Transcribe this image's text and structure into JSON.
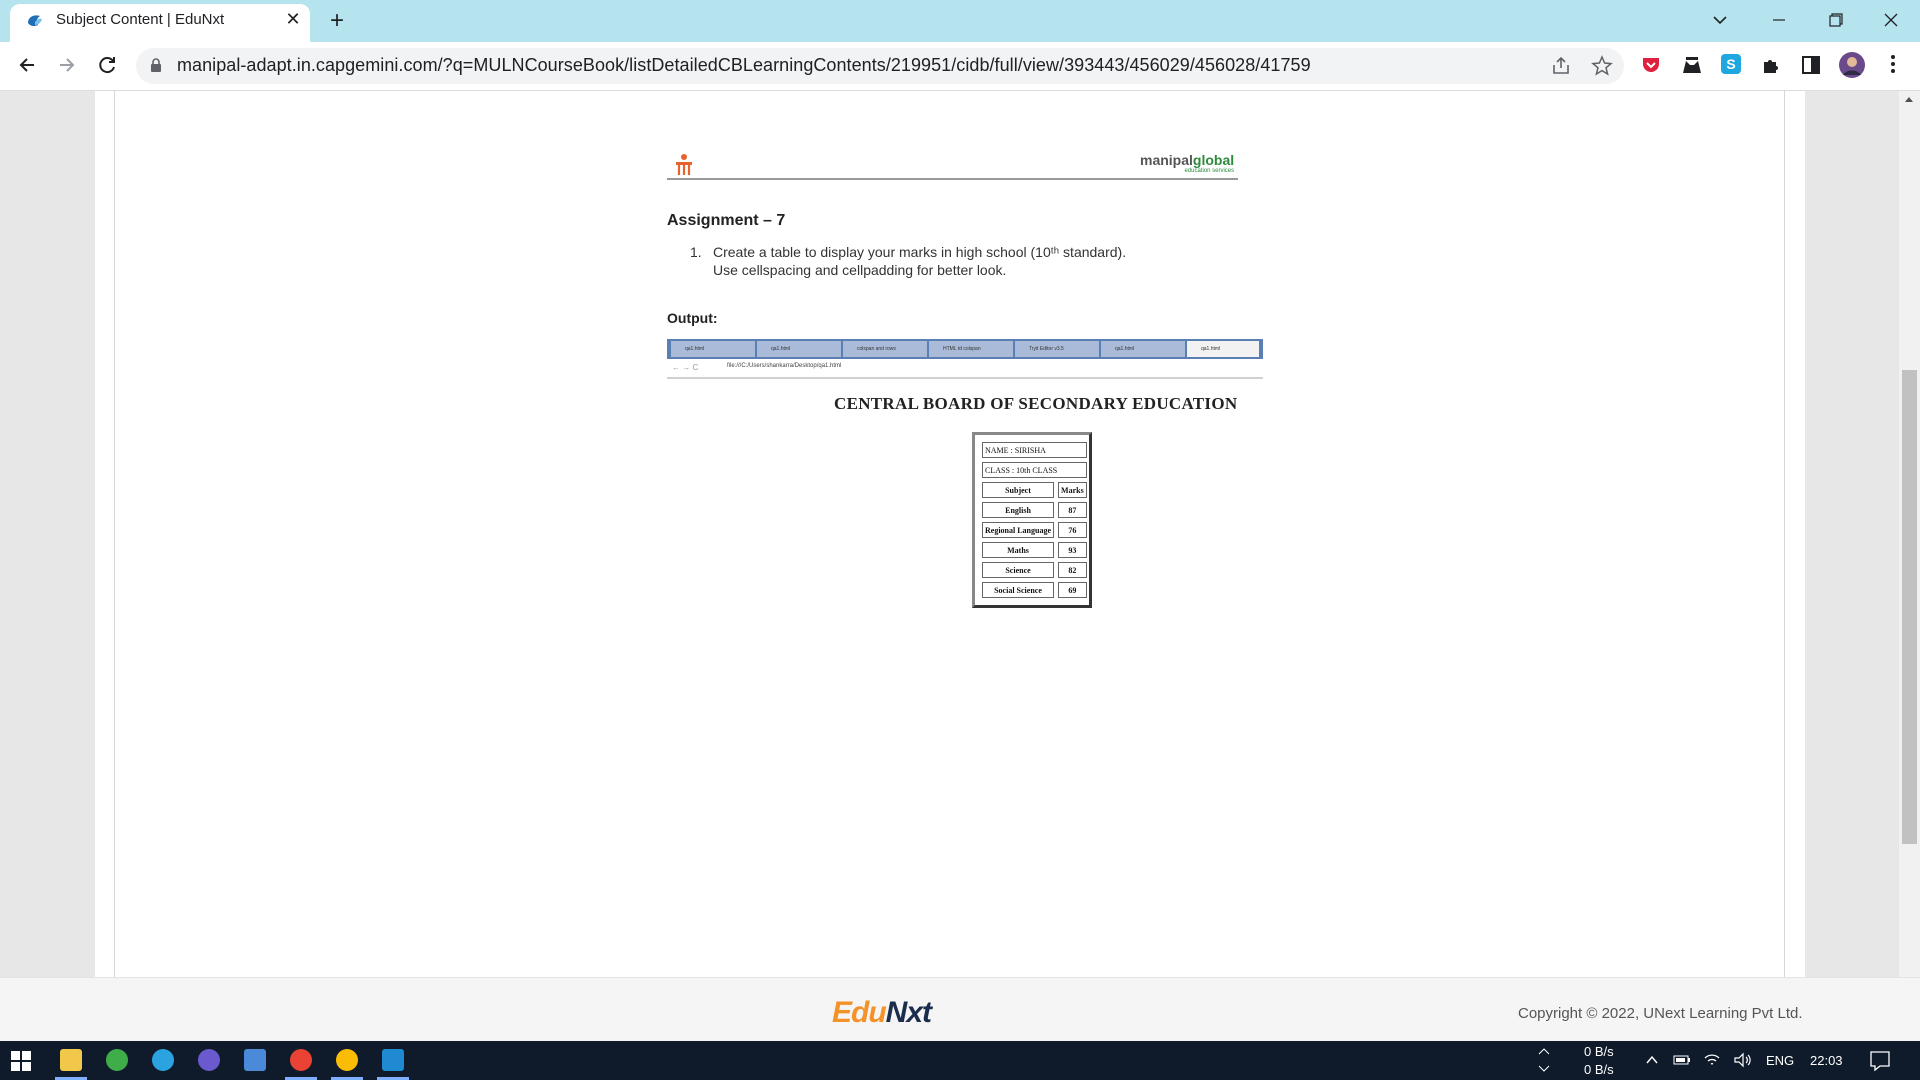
{
  "browser": {
    "tab_title": "Subject Content | EduNxt",
    "tab_close": "✕",
    "new_tab": "+",
    "url": "manipal-adapt.in.capgemini.com/?q=MULNCourseBook/listDetailedCBLearningContents/219951/cidb/full/view/393443/456029/456028/41759"
  },
  "document": {
    "brand_name_a": "manipal",
    "brand_name_b": "global",
    "brand_sub": "education services",
    "assignment_title": "Assignment – 7",
    "instruction_number": "1.",
    "instruction_line1": "Create a table to display your marks in high school (10ᵗʰ standard).",
    "instruction_line2": "Use cellspacing and cellpadding for better look.",
    "output_label": "Output:",
    "mini_browser": {
      "tabs": [
        "qa1.html",
        "qa1.html",
        "colspan and rows",
        "HTML td colspan",
        "Tryit Editor v3.5",
        "qa1.html",
        "qa1.html"
      ],
      "nav": "← → C",
      "url": "file:///C:/Users/shankarra/Desktop/qa1.html"
    },
    "heading": "CENTRAL BOARD OF SECONDARY EDUCATION",
    "marks": {
      "name_row": "NAME : SIRISHA",
      "class_row": "CLASS : 10th CLASS",
      "header": [
        "Subject",
        "Marks"
      ],
      "rows": [
        [
          "English",
          "87"
        ],
        [
          "Regional Language",
          "76"
        ],
        [
          "Maths",
          "93"
        ],
        [
          "Science",
          "82"
        ],
        [
          "Social Science",
          "69"
        ]
      ]
    }
  },
  "footer": {
    "logo_edu": "Edu",
    "logo_next": "Nxt",
    "copyright": "Copyright © 2022, UNext Learning Pvt Ltd."
  },
  "taskbar": {
    "net_up": "0 B/s",
    "net_down": "0 B/s",
    "language": "ENG",
    "time": "22:03"
  },
  "colors": {
    "tabstrip": "#b5e4ef",
    "brand_green": "#2d8a3e",
    "edunxt_orange": "#f39229",
    "edunxt_navy": "#1c2c4c",
    "taskbar": "#0f1b2b"
  }
}
